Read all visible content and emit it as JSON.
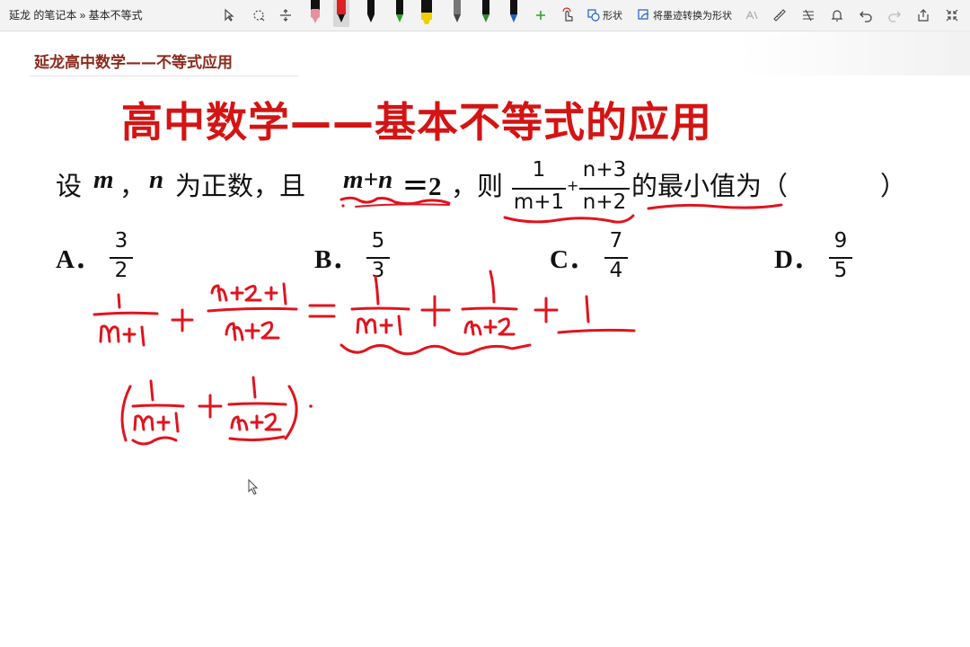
{
  "breadcrumb": "延龙 的笔记本 » 基本不等式",
  "toolbar": {
    "shape_label": "形状",
    "ink_to_shape_label": "将墨迹转换为形状",
    "pen_colors": [
      "#e8909c",
      "#e02020",
      "#111111",
      "#2aa52a",
      "#f0d000",
      "#444444",
      "#2e8b2e",
      "#2060c0"
    ]
  },
  "notebook_header": "延龙高中数学——不等式应用",
  "page_title": "高中数学——基本不等式的应用",
  "question": {
    "prefix": "设",
    "var_m": "m",
    "sep1": "，",
    "var_n": "n",
    "mid": "为正数，且",
    "condition": "m+n",
    "eq": "＝2",
    "then": "，则",
    "frac1_num": "1",
    "frac1_den": "m+1",
    "plus": "+",
    "frac2_num": "n+3",
    "frac2_den": "n+2",
    "suffix": "的最小值为（",
    "close": "）"
  },
  "options": [
    {
      "letter": "A．",
      "num": "3",
      "den": "2"
    },
    {
      "letter": "B．",
      "num": "5",
      "den": "3"
    },
    {
      "letter": "C．",
      "num": "7",
      "den": "4"
    },
    {
      "letter": "D．",
      "num": "9",
      "den": "5"
    }
  ],
  "ink_color": "#e0141e"
}
